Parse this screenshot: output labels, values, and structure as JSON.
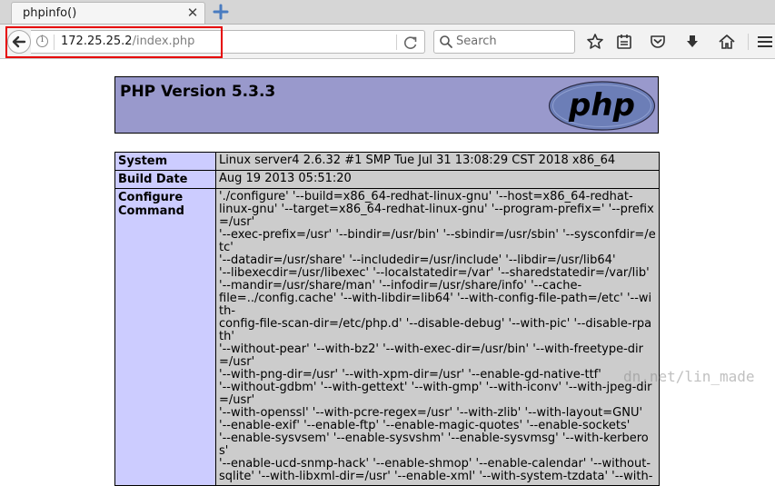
{
  "browser": {
    "tab": {
      "title": "phpinfo()"
    },
    "address": {
      "host": "172.25.25.2",
      "path": "/index.php"
    },
    "search": {
      "placeholder": "Search"
    }
  },
  "page": {
    "header_title": "PHP Version 5.3.3",
    "logo_text": "php",
    "rows": [
      {
        "label": "System",
        "value": "Linux server4 2.6.32 #1 SMP Tue Jul 31 13:08:29 CST 2018 x86_64"
      },
      {
        "label": "Build Date",
        "value": "Aug 19 2013 05:51:20"
      },
      {
        "label": "Configure Command",
        "value": "'./configure' '--build=x86_64-redhat-linux-gnu' '--host=x86_64-redhat-\nlinux-gnu' '--target=x86_64-redhat-linux-gnu' '--program-prefix=' '--prefix=/usr'\n'--exec-prefix=/usr' '--bindir=/usr/bin' '--sbindir=/usr/sbin' '--sysconfdir=/etc'\n'--datadir=/usr/share' '--includedir=/usr/include' '--libdir=/usr/lib64'\n'--libexecdir=/usr/libexec' '--localstatedir=/var' '--sharedstatedir=/var/lib'\n'--mandir=/usr/share/man' '--infodir=/usr/share/info' '--cache-\nfile=../config.cache' '--with-libdir=lib64' '--with-config-file-path=/etc' '--with-\nconfig-file-scan-dir=/etc/php.d' '--disable-debug' '--with-pic' '--disable-rpath'\n'--without-pear' '--with-bz2' '--with-exec-dir=/usr/bin' '--with-freetype-dir=/usr'\n'--with-png-dir=/usr' '--with-xpm-dir=/usr' '--enable-gd-native-ttf'\n'--without-gdbm' '--with-gettext' '--with-gmp' '--with-iconv' '--with-jpeg-dir=/usr'\n'--with-openssl' '--with-pcre-regex=/usr' '--with-zlib' '--with-layout=GNU'\n'--enable-exif' '--enable-ftp' '--enable-magic-quotes' '--enable-sockets'\n'--enable-sysvsem' '--enable-sysvshm' '--enable-sysvmsg' '--with-kerberos'\n'--enable-ucd-snmp-hack' '--enable-shmop' '--enable-calendar' '--without-\nsqlite' '--with-libxml-dir=/usr' '--enable-xml' '--with-system-tzdata' '--with-"
      }
    ]
  },
  "watermark": "dn.net/lin_made",
  "colors": {
    "header_bg": "#9999cc",
    "label_bg": "#ccccff",
    "value_bg": "#cccccc",
    "highlight": "#e60000"
  }
}
